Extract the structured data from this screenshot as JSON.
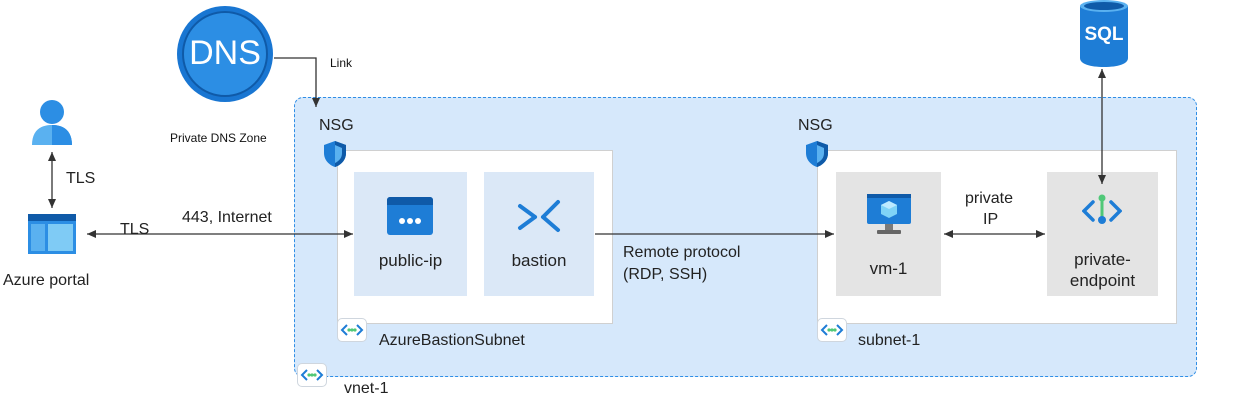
{
  "dns": {
    "icon_text": "DNS",
    "label": "Private DNS Zone",
    "link_label": "Link"
  },
  "sql": {
    "icon_text": "SQL"
  },
  "user": {
    "tls_label": "TLS"
  },
  "portal": {
    "label": "Azure portal",
    "tls_label": "TLS"
  },
  "connection": {
    "label": "443, Internet"
  },
  "vnet": {
    "label": "vnet-1"
  },
  "bastion_subnet": {
    "nsg_label": "NSG",
    "label": "AzureBastionSubnet",
    "public_ip_label": "public-ip",
    "bastion_label": "bastion"
  },
  "remote": {
    "line1": "Remote protocol",
    "line2": "(RDP, SSH)"
  },
  "subnet1": {
    "nsg_label": "NSG",
    "label": "subnet-1",
    "vm_label": "vm-1",
    "endpoint_line1": "private-",
    "endpoint_line2": "endpoint"
  },
  "private_ip": {
    "line1": "private",
    "line2": "IP"
  },
  "colors": {
    "vnet_fill": "#d6e8fb",
    "vnet_border": "#2f8ee6",
    "azure_blue": "#0078d4"
  }
}
